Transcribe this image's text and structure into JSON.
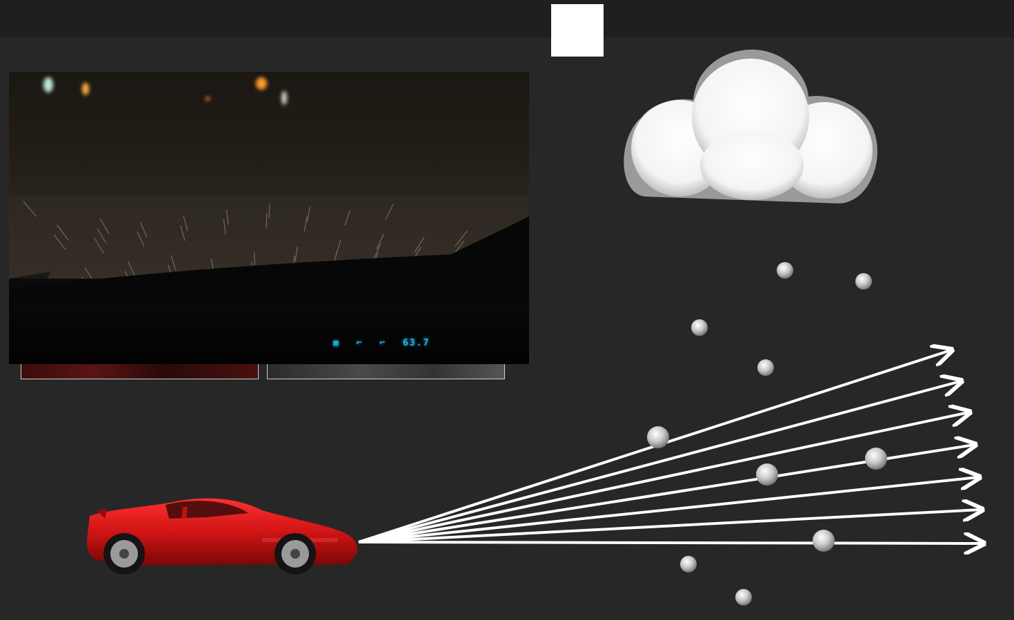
{
  "scene": {
    "background": "#272727",
    "topbar_color": "#1f1f1f"
  },
  "photo": {
    "description_icons": [
      "camera-icon",
      "seat-icon",
      "seat-icon",
      "odometer-icon"
    ],
    "display_color": "#19b6e8",
    "display_value": "63.7"
  },
  "diagram": {
    "icons": [
      "cloud-icon",
      "red-sports-car-icon",
      "raindrop-icon",
      "arrow-icon"
    ],
    "beam_color": "#ffffff",
    "car_color": "#d01414",
    "raindrop_color": "#bdbdbd",
    "beam_count": 7
  }
}
